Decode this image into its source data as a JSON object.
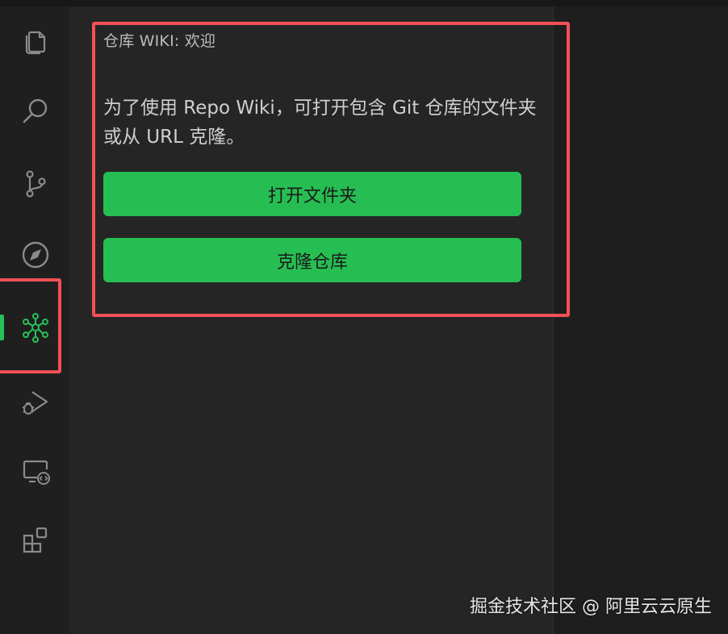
{
  "activity_bar": {
    "items": [
      {
        "name": "explorer",
        "icon": "files-icon",
        "active": false
      },
      {
        "name": "search",
        "icon": "search-icon",
        "active": false
      },
      {
        "name": "source-control",
        "icon": "source-control-icon",
        "active": false
      },
      {
        "name": "explore",
        "icon": "compass-icon",
        "active": false
      },
      {
        "name": "repo-wiki",
        "icon": "repo-wiki-icon",
        "active": true
      },
      {
        "name": "run-debug",
        "icon": "run-debug-icon",
        "active": false
      },
      {
        "name": "remote",
        "icon": "remote-explorer-icon",
        "active": false
      },
      {
        "name": "extensions",
        "icon": "extensions-icon",
        "active": false
      }
    ],
    "accent_color": "#26c159"
  },
  "panel": {
    "title": "仓库 WIKI: 欢迎",
    "description": "为了使用 Repo Wiki，可打开包含 Git 仓库的文件夹或从 URL 克隆。",
    "open_folder_label": "打开文件夹",
    "clone_repo_label": "克隆仓库",
    "button_color": "#26be52"
  },
  "annotations": {
    "highlight_color": "#f35057"
  },
  "watermark": {
    "text": "掘金技术社区 @ 阿里云云原生"
  }
}
